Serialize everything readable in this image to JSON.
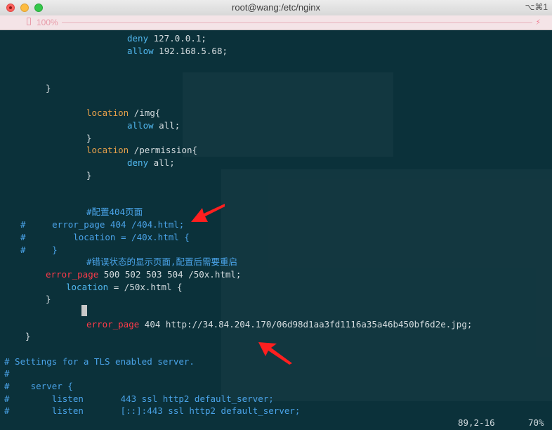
{
  "window": {
    "title": "root@wang:/etc/nginx",
    "shortcut": "⌥⌘1"
  },
  "tabbar": {
    "zoom": "100%",
    "bolt": "⚡"
  },
  "lines": {
    "l1": {
      "kw": "deny",
      "rest": " 127.0.0.1;"
    },
    "l2": {
      "kw": "allow",
      "rest": " 192.168.5.68;"
    },
    "l3": "}",
    "l4": {
      "kw": "location",
      "rest": " /img{"
    },
    "l5": {
      "kw": "allow",
      "rest": " all;"
    },
    "l6": "}",
    "l7": {
      "kw": "location",
      "rest": " /permission{"
    },
    "l8": {
      "kw": "deny",
      "rest": " all;"
    },
    "l9": "}",
    "l10": "#配置404页面",
    "l11": "#     error_page 404 /404.html;",
    "l12": "#         location = /40x.html {",
    "l13": "#     }",
    "l14": "#错误状态的显示页面,配置后需要重启",
    "l15": {
      "kw": "error_page",
      "rest": " 500 502 503 504 /50x.html;"
    },
    "l16": {
      "kw": "location",
      "rest": " = /50x.html {"
    },
    "l17": "}",
    "l18": {
      "kw": "error_page",
      "rest": " 404 http://34.84.204.170/06d98d1aa3fd1116a35a46b450bf6d2e.jpg;"
    },
    "l19": "}",
    "l20": "# Settings for a TLS enabled server.",
    "l21": "#",
    "l22": "#    server {",
    "l23": "#        listen       443 ssl http2 default_server;",
    "l24": "#        listen       [::]:443 ssl http2 default_server;"
  },
  "status": {
    "position": "89,2-16",
    "percent": "70%"
  },
  "colors": {
    "background": "#0b313a",
    "keyword": "#e8a04a",
    "value_keyword": "#52b8f0",
    "comment": "#4aa3e8",
    "error_keyword": "#ff3b4a",
    "arrow": "#ff1f1f"
  }
}
